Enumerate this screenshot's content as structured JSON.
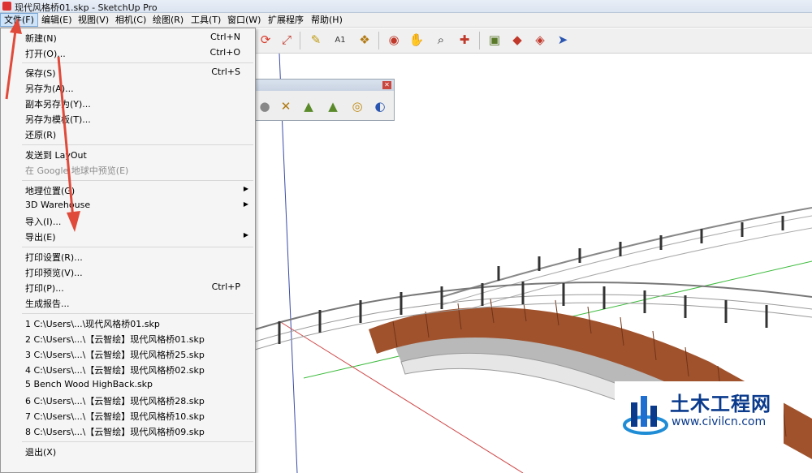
{
  "window": {
    "title": "现代风格桥01.skp - SketchUp Pro"
  },
  "menubar": [
    {
      "label": "文件(F)",
      "active": true
    },
    {
      "label": "编辑(E)"
    },
    {
      "label": "视图(V)"
    },
    {
      "label": "相机(C)"
    },
    {
      "label": "绘图(R)"
    },
    {
      "label": "工具(T)"
    },
    {
      "label": "窗口(W)"
    },
    {
      "label": "扩展程序"
    },
    {
      "label": "帮助(H)"
    }
  ],
  "file_menu": {
    "new": {
      "label": "新建(N)",
      "shortcut": "Ctrl+N"
    },
    "open": {
      "label": "打开(O)...",
      "shortcut": "Ctrl+O"
    },
    "save": {
      "label": "保存(S)",
      "shortcut": "Ctrl+S"
    },
    "save_as": {
      "label": "另存为(A)..."
    },
    "save_copy_as": {
      "label": "副本另存为(Y)..."
    },
    "save_as_template": {
      "label": "另存为模板(T)..."
    },
    "revert": {
      "label": "还原(R)"
    },
    "send_to_layout": {
      "label": "发送到 LayOut"
    },
    "preview_google_earth": {
      "label": "在 Google 地球中预览(E)"
    },
    "geo_location": {
      "label": "地理位置(G)"
    },
    "warehouse": {
      "label": "3D Warehouse"
    },
    "import": {
      "label": "导入(I)..."
    },
    "export": {
      "label": "导出(E)"
    },
    "print_setup": {
      "label": "打印设置(R)..."
    },
    "print_preview": {
      "label": "打印预览(V)..."
    },
    "print": {
      "label": "打印(P)...",
      "shortcut": "Ctrl+P"
    },
    "generate_report": {
      "label": "生成报告..."
    },
    "recent": [
      "1 C:\\Users\\...\\现代风格桥01.skp",
      "2 C:\\Users\\...\\【云智绘】现代风格桥01.skp",
      "3 C:\\Users\\...\\【云智绘】现代风格桥25.skp",
      "4 C:\\Users\\...\\【云智绘】现代风格桥02.skp",
      "5 Bench Wood HighBack.skp",
      "6 C:\\Users\\...\\【云智绘】现代风格桥28.skp",
      "7 C:\\Users\\...\\【云智绘】现代风格桥10.skp",
      "8 C:\\Users\\...\\【云智绘】现代风格桥09.skp"
    ],
    "exit": {
      "label": "退出(X)"
    }
  },
  "watermark": {
    "title": "土木工程网",
    "url": "www.civilcn.com"
  },
  "colors": {
    "menu_highlight": "#cfe3f8",
    "annotation_arrow": "#e04a3a",
    "watermark": "#0a3a8c",
    "deck_wood": "#a0522d"
  }
}
